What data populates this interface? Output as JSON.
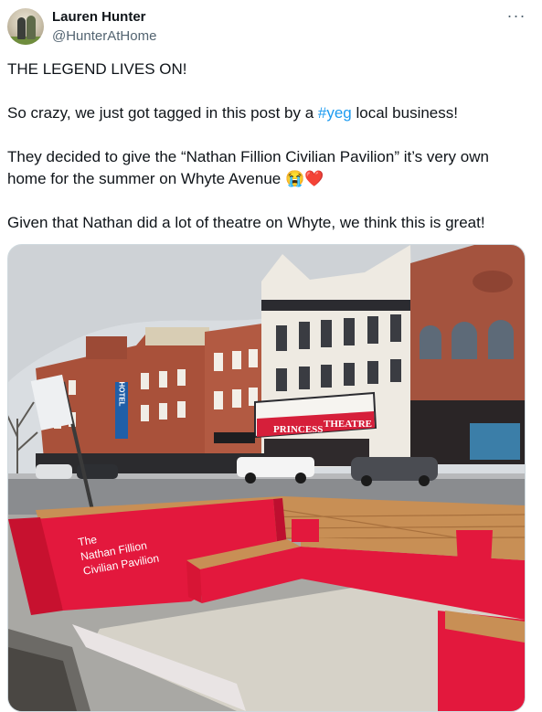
{
  "author": {
    "name": "Lauren Hunter",
    "handle": "@HunterAtHome"
  },
  "more_button_label": "···",
  "tweet": {
    "line1": "THE LEGEND LIVES ON!",
    "line2_before": "So crazy, we just got tagged in this post by a ",
    "line2_hashtag": "#yeg",
    "line2_after": " local business!",
    "line3": "They decided to give the “Nathan Fillion Civilian Pavilion” it’s very own",
    "line4_text": "home for the summer on Whyte Avenue ",
    "line4_emoji_1": "😭",
    "line4_emoji_2": "❤️",
    "line5": "Given that Nathan did a lot of theatre on Whyte, we think this is great!"
  },
  "photo": {
    "sign_line_1": "The",
    "sign_line_2": "Nathan Fillion",
    "sign_line_3": "Civilian Pavilion",
    "marquee_top": "PRINCESS",
    "marquee_right": "THEATRE",
    "hotel_sign": "HOTEL",
    "colors": {
      "sky": "#d9dde1",
      "pavilion_red": "#e3183d",
      "wood": "#c88f55",
      "brick": "#a4533e"
    }
  }
}
